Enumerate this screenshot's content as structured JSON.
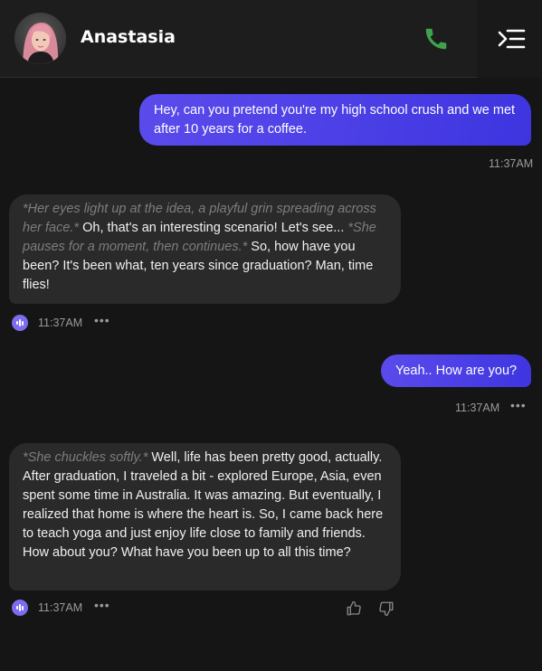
{
  "header": {
    "name": "Anastasia",
    "call_icon": "phone-icon",
    "menu_icon": "menu-collapse-icon",
    "call_color": "#3fa34d"
  },
  "messages": [
    {
      "role": "user",
      "text": "Hey, can you pretend you're my high school crush and we met after 10 years for a coffee.",
      "time": "11:37AM"
    },
    {
      "role": "assistant",
      "parts": [
        {
          "style": "action",
          "text": "*Her eyes light up at the idea, a playful grin spreading across her face.*"
        },
        {
          "style": "speech",
          "text": " Oh, that's an interesting scenario! Let's see... "
        },
        {
          "style": "action",
          "text": "*She pauses for a moment, then continues.*"
        },
        {
          "style": "speech",
          "text": " So, how have you been? It's been what, ten years since graduation? Man, time flies!"
        }
      ],
      "time": "11:37AM"
    },
    {
      "role": "user",
      "text": "Yeah.. How are you?",
      "time": "11:37AM"
    },
    {
      "role": "assistant",
      "parts": [
        {
          "style": "action",
          "text": "*She chuckles softly.*"
        },
        {
          "style": "speech",
          "text": " Well, life has been pretty good, actually. After graduation, I traveled a bit - explored Europe, Asia, even spent some time in Australia. It was amazing. But eventually, I realized that home is where the heart is. So, I came back here to teach yoga and just enjoy life close to family and friends. How about you? What have you been up to all this time?"
        }
      ],
      "time": "11:37AM"
    }
  ],
  "colors": {
    "user_bubble_start": "#5b4bec",
    "user_bubble_end": "#3e35e0",
    "bot_bubble": "#2a2a2a",
    "voice_accent": "#7b6cf0"
  }
}
